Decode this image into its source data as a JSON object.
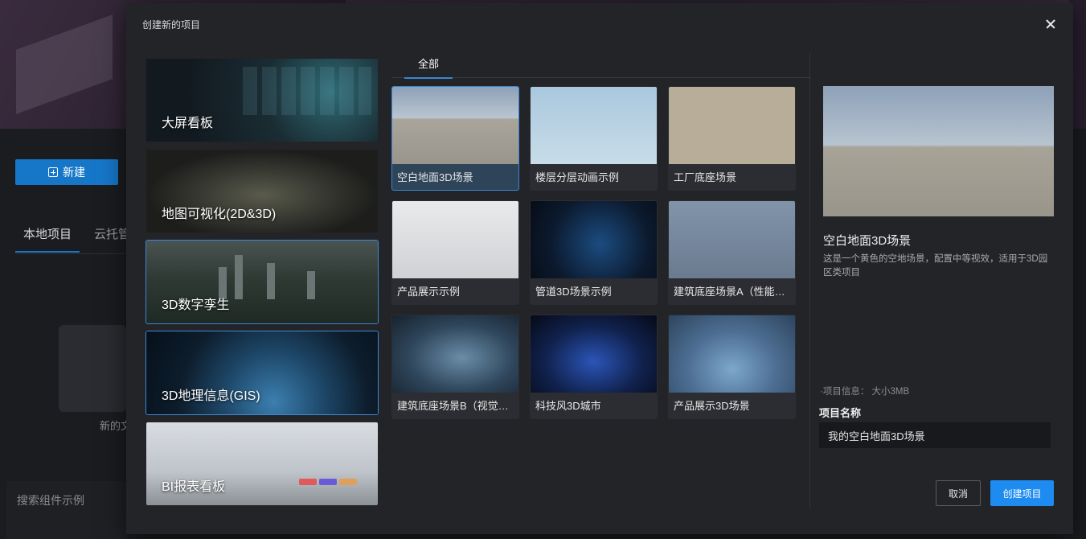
{
  "background": {
    "new_button_label": "新建",
    "tabs": [
      "本地项目",
      "云托管"
    ],
    "folder_label": "新的文",
    "search_label": "搜索组件示例"
  },
  "modal": {
    "title": "创建新的项目",
    "categories": [
      {
        "label": "大屏看板",
        "active": false
      },
      {
        "label": "地图可视化(2D&3D)",
        "active": false
      },
      {
        "label": "3D数字孪生",
        "active": true
      },
      {
        "label": "3D地理信息(GIS)",
        "active": true
      },
      {
        "label": "BI报表看板",
        "active": false
      }
    ],
    "gallery_tab": "全部",
    "templates": [
      {
        "label": "空白地面3D场景",
        "thumb": "empty-ground-scene",
        "active": true
      },
      {
        "label": "楼层分层动画示例",
        "thumb": "tower-floors-scene",
        "active": false
      },
      {
        "label": "工厂底座场景",
        "thumb": "factory-base-scene",
        "active": false
      },
      {
        "label": "产品展示示例",
        "thumb": "car-product-scene",
        "active": false
      },
      {
        "label": "管道3D场景示例",
        "thumb": "pipeline-scene",
        "active": false
      },
      {
        "label": "建筑底座场景A（性能优...",
        "thumb": "building-base-a-scene",
        "active": false
      },
      {
        "label": "建筑底座场景B（视觉优...",
        "thumb": "building-base-b-scene",
        "active": false
      },
      {
        "label": "科技风3D城市",
        "thumb": "tech-city-scene",
        "active": false
      },
      {
        "label": "产品展示3D场景",
        "thumb": "product-3d-scene",
        "active": false
      }
    ],
    "detail": {
      "title": "空白地面3D场景",
      "description": "这是一个黄色的空地场景，配置中等视效，适用于3D园区类项目",
      "info": "·项目信息： 大小3MB",
      "name_label": "项目名称",
      "name_value": "我的空白地面3D场景"
    },
    "buttons": {
      "cancel": "取消",
      "create": "创建项目"
    }
  },
  "colors": {
    "accent": "#1e8bf0",
    "active_border": "#3d86d6",
    "modal_bg": "#232428"
  }
}
